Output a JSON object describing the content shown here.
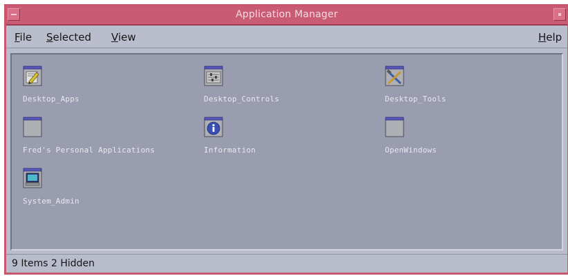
{
  "window": {
    "title": "Application Manager"
  },
  "menubar": {
    "file_underline": "F",
    "file_rest": "ile",
    "selected_underline": "S",
    "selected_rest": "elected",
    "view_underline": "V",
    "view_rest": "iew",
    "help_underline": "H",
    "help_rest": "elp"
  },
  "apps": [
    {
      "label": "Desktop_Apps",
      "icon": "desktop-apps-icon"
    },
    {
      "label": "Desktop_Controls",
      "icon": "desktop-controls-icon"
    },
    {
      "label": "Desktop_Tools",
      "icon": "desktop-tools-icon"
    },
    {
      "label": "Fred's Personal Applications",
      "icon": "folder-icon"
    },
    {
      "label": "Information",
      "icon": "information-icon"
    },
    {
      "label": "OpenWindows",
      "icon": "folder-icon"
    },
    {
      "label": "System_Admin",
      "icon": "system-admin-icon"
    }
  ],
  "status": {
    "text": "9 Items 2 Hidden"
  },
  "colors": {
    "titlebar": "#c95b74",
    "frame": "#c7566f",
    "menubar": "#babdcb",
    "content_bg": "#9a9caf",
    "label_text": "#e8e9f0"
  }
}
